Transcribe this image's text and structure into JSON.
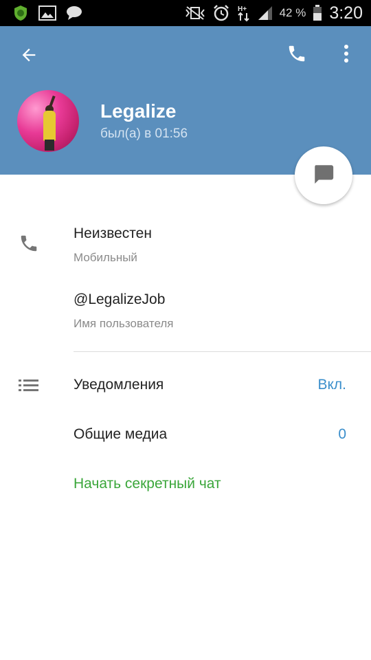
{
  "status_bar": {
    "battery_percent": "42 %",
    "time": "3:20",
    "network": "H+",
    "icons": [
      "shield-app-icon",
      "image-icon",
      "chat-bubble-icon",
      "vibrate-off-icon",
      "alarm-icon",
      "network-arrows-icon",
      "signal-icon",
      "battery-icon"
    ]
  },
  "header": {
    "name": "Legalize",
    "status": "был(а) в 01:56",
    "background_color": "#5b8fbd",
    "icons": [
      "back-arrow-icon",
      "phone-icon",
      "more-vert-icon"
    ]
  },
  "fab": {
    "icon": "message-icon"
  },
  "contact": {
    "phone_value": "Неизвестен",
    "phone_label": "Мобильный",
    "username_value": "@LegalizeJob",
    "username_label": "Имя пользователя"
  },
  "settings": {
    "notifications_label": "Уведомления",
    "notifications_value": "Вкл.",
    "media_label": "Общие медиа",
    "media_value": "0",
    "secret_chat_label": "Начать секретный чат",
    "accent_color": "#3a8ecb",
    "secret_color": "#3aa63a"
  }
}
